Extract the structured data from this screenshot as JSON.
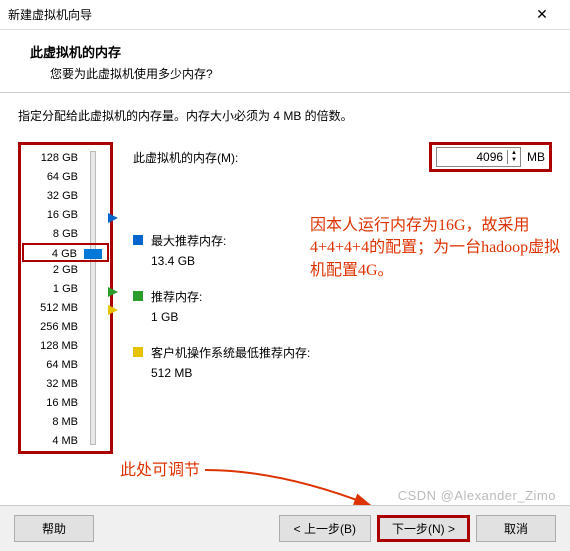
{
  "window": {
    "title": "新建虚拟机向导",
    "close": "✕"
  },
  "header": {
    "title": "此虚拟机的内存",
    "subtitle": "您要为此虚拟机使用多少内存?"
  },
  "instruction": "指定分配给此虚拟机的内存量。内存大小必须为 4 MB 的倍数。",
  "memory": {
    "label": "此虚拟机的内存(M):",
    "value": "4096",
    "unit": "MB"
  },
  "ticks": [
    "128 GB",
    "64 GB",
    "32 GB",
    "16 GB",
    "8 GB",
    "4 GB",
    "2 GB",
    "1 GB",
    "512 MB",
    "256 MB",
    "128 MB",
    "64 MB",
    "32 MB",
    "16 MB",
    "8 MB",
    "4 MB"
  ],
  "selected_tick": "4 GB",
  "recs": {
    "max": {
      "label": "最大推荐内存:",
      "value": "13.4 GB"
    },
    "rec": {
      "label": "推荐内存:",
      "value": "1 GB"
    },
    "min": {
      "label": "客户机操作系统最低推荐内存:",
      "value": "512 MB"
    }
  },
  "annotations": {
    "note1": "因本人运行内存为16G，故采用4+4+4+4的配置；为一台hadoop虚拟机配置4G。",
    "note2": "此处可调节"
  },
  "footer": {
    "help": "帮助",
    "back": "< 上一步(B)",
    "next": "下一步(N) >",
    "cancel": "取消"
  },
  "watermark": "CSDN @Alexander_Zimo"
}
